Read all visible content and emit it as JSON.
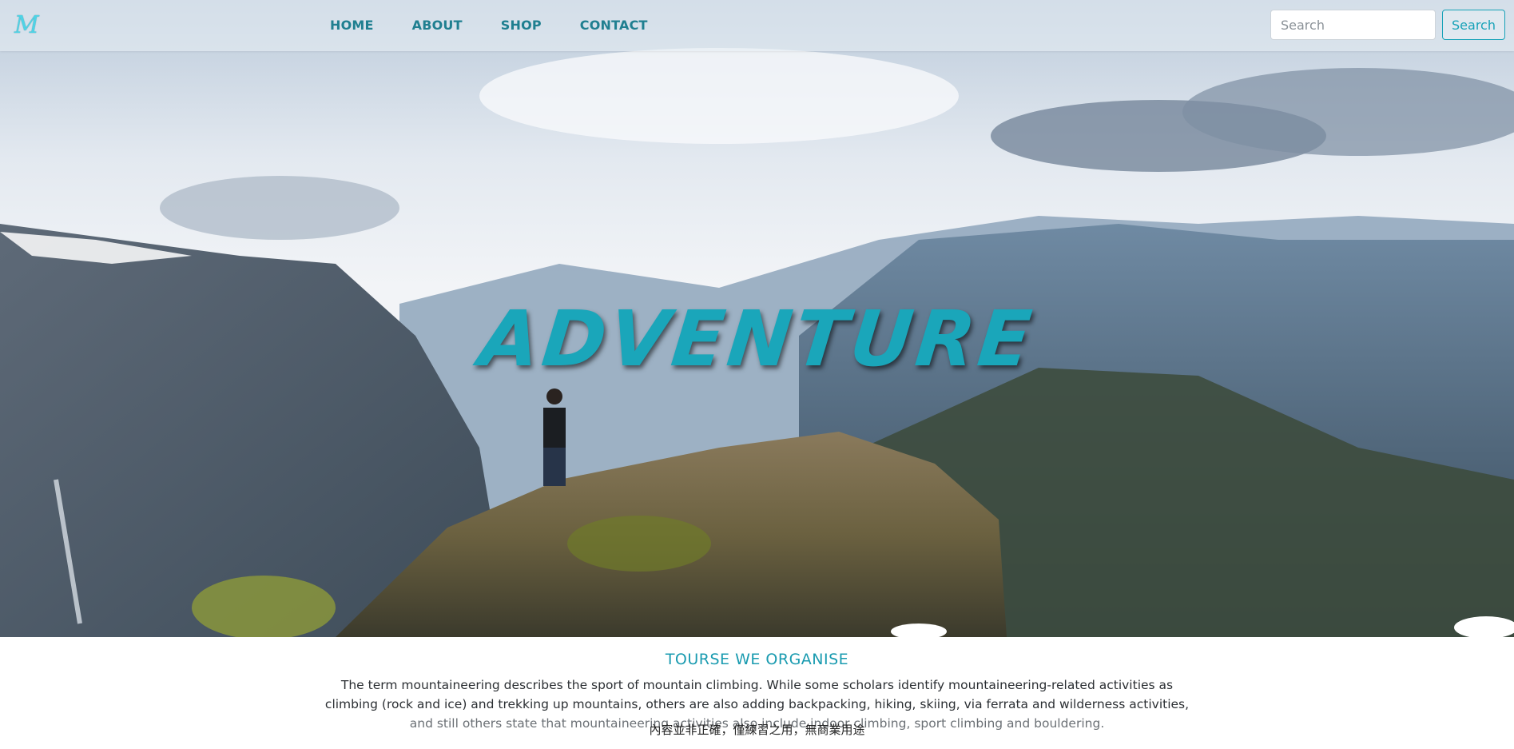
{
  "brand": {
    "logo_text": "M",
    "color": "#4fd3e6"
  },
  "nav": {
    "items": [
      {
        "label": "HOME"
      },
      {
        "label": "ABOUT"
      },
      {
        "label": "SHOP"
      },
      {
        "label": "CONTACT"
      }
    ],
    "color": "#1f7f90"
  },
  "search": {
    "placeholder": "Search",
    "button_label": "Search",
    "accent": "#17a2b8"
  },
  "hero": {
    "title": "ADVENTURE",
    "title_color": "#1aa6ba",
    "image": "mountain-landscape-hiker-on-cliff"
  },
  "tours": {
    "heading": "TOURSE WE ORGANISE",
    "text_line1": "The term mountaineering describes the sport of mountain climbing. While some scholars identify mountaineering-related activities as",
    "text_line2": "climbing (rock and ice) and trekking up mountains, others are also adding backpacking, hiking, skiing, via ferrata and wilderness activities,",
    "text_line3": "and still others state that mountaineering activities also include indoor climbing, sport climbing and bouldering."
  },
  "disclaimer": "內容並非正確，僅練習之用，無商業用途"
}
